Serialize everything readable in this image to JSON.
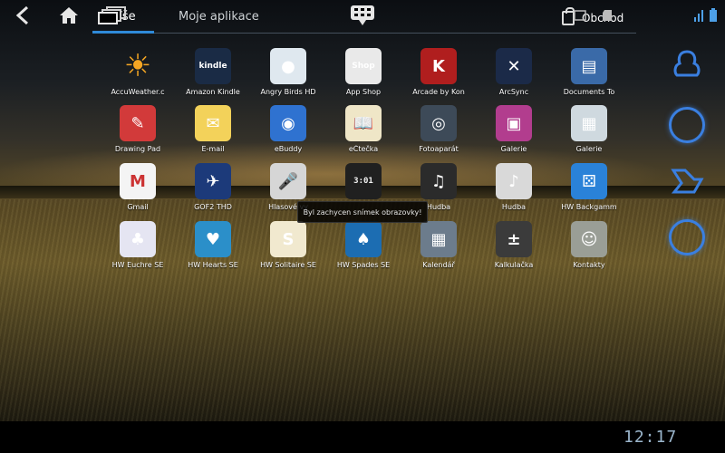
{
  "tabs": {
    "all": "Vše",
    "my_apps": "Moje aplikace"
  },
  "store_label": "Obchod",
  "toast": "Byl zachycen snímek obrazovky!",
  "status": {
    "time": "12:17"
  },
  "apps": [
    {
      "label": "AccuWeather.c",
      "icon": "sun-icon",
      "color": "#f5a623"
    },
    {
      "label": "Amazon Kindle",
      "icon": "kindle-icon",
      "color": "#1a2b45"
    },
    {
      "label": "Angry Birds HD",
      "icon": "angry-bird-icon",
      "color": "#dfe8ef"
    },
    {
      "label": "App Shop",
      "icon": "lenovo-shop-icon",
      "color": "#e9e9e9"
    },
    {
      "label": "Arcade by Kon",
      "icon": "k-icon",
      "color": "#b01e1e"
    },
    {
      "label": "ArcSync",
      "icon": "arcsync-icon",
      "color": "#1b2a48"
    },
    {
      "label": "Documents To",
      "icon": "documents-icon",
      "color": "#3a6aa8"
    },
    {
      "label": "Drawing Pad",
      "icon": "drawing-pad-icon",
      "color": "#d23a3a"
    },
    {
      "label": "E-mail",
      "icon": "envelope-icon",
      "color": "#f3d25a"
    },
    {
      "label": "eBuddy",
      "icon": "ebuddy-icon",
      "color": "#2f72d0"
    },
    {
      "label": "eČtečka",
      "icon": "book-icon",
      "color": "#efe6c7"
    },
    {
      "label": "Fotoaparát",
      "icon": "camera-icon",
      "color": "#3d4a58"
    },
    {
      "label": "Galerie",
      "icon": "gallery-icon",
      "color": "#b23d8e"
    },
    {
      "label": "Galerie",
      "icon": "photos-icon",
      "color": "#cfd9df"
    },
    {
      "label": "Gmail",
      "icon": "gmail-icon",
      "color": "#f4f4f4"
    },
    {
      "label": "GOF2 THD",
      "icon": "spaceship-icon",
      "color": "#1c3a7a"
    },
    {
      "label": "Hlasové vy",
      "icon": "microphone-icon",
      "color": "#d6d6d6"
    },
    {
      "label": "",
      "icon": "clock-widget-icon",
      "color": "#202020"
    },
    {
      "label": "Hudba",
      "icon": "headphones-icon",
      "color": "#2b2b2b"
    },
    {
      "label": "Hudba",
      "icon": "music-disc-icon",
      "color": "#d9d9d9"
    },
    {
      "label": "HW Backgamm",
      "icon": "dice-icon",
      "color": "#2a82d8"
    },
    {
      "label": "HW Euchre SE",
      "icon": "euchre-icon",
      "color": "#e5e5f2"
    },
    {
      "label": "HW Hearts SE",
      "icon": "hearts-icon",
      "color": "#2b8fc9"
    },
    {
      "label": "HW Solitaire SE",
      "icon": "solitaire-icon",
      "color": "#f1e9cf"
    },
    {
      "label": "HW Spades SE",
      "icon": "spades-icon",
      "color": "#1c6db2"
    },
    {
      "label": "Kalendář",
      "icon": "calendar-icon",
      "color": "#6c7c8c"
    },
    {
      "label": "Kalkulačka",
      "icon": "calculator-icon",
      "color": "#3b3b3b"
    },
    {
      "label": "Kontakty",
      "icon": "contacts-icon",
      "color": "#9a9e96"
    }
  ],
  "accent": "#2f8ad8"
}
